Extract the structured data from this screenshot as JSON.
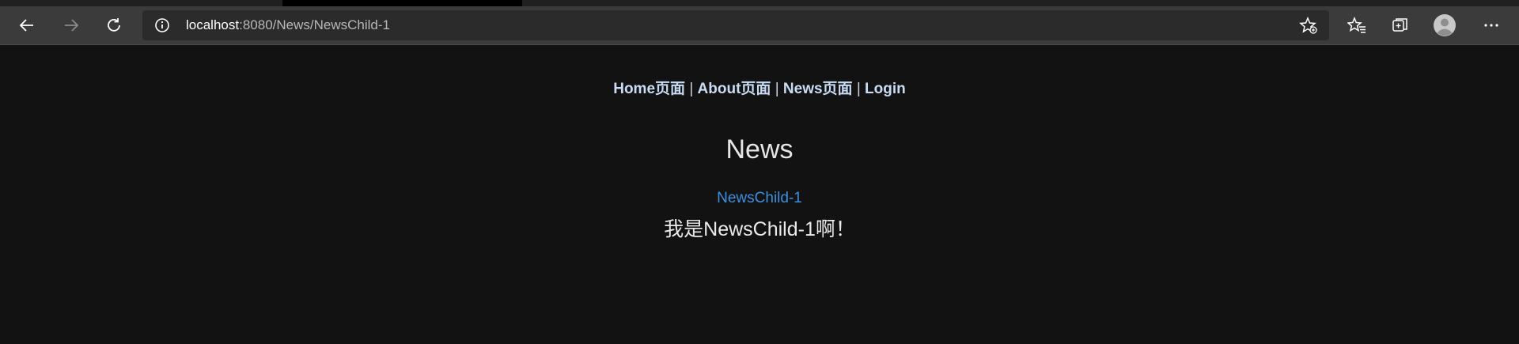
{
  "browser": {
    "url_host": "localhost",
    "url_path": ":8080/News/NewsChild-1"
  },
  "nav": {
    "items": [
      {
        "label": "Home页面"
      },
      {
        "label": "About页面"
      },
      {
        "label": "News页面"
      },
      {
        "label": "Login"
      }
    ],
    "separator": "|"
  },
  "main": {
    "title": "News",
    "child_link": "NewsChild-1",
    "child_text": "我是NewsChild-1啊！"
  },
  "colors": {
    "page_bg": "#121212",
    "toolbar_bg": "#3b3b3b",
    "link_blue": "#3d8fe0",
    "nav_link": "#c8dcf4"
  },
  "icons": [
    "back-arrow-icon",
    "forward-arrow-icon",
    "refresh-icon",
    "info-icon",
    "add-favorite-icon",
    "favorites-icon",
    "collections-icon",
    "profile-icon",
    "more-icon"
  ]
}
